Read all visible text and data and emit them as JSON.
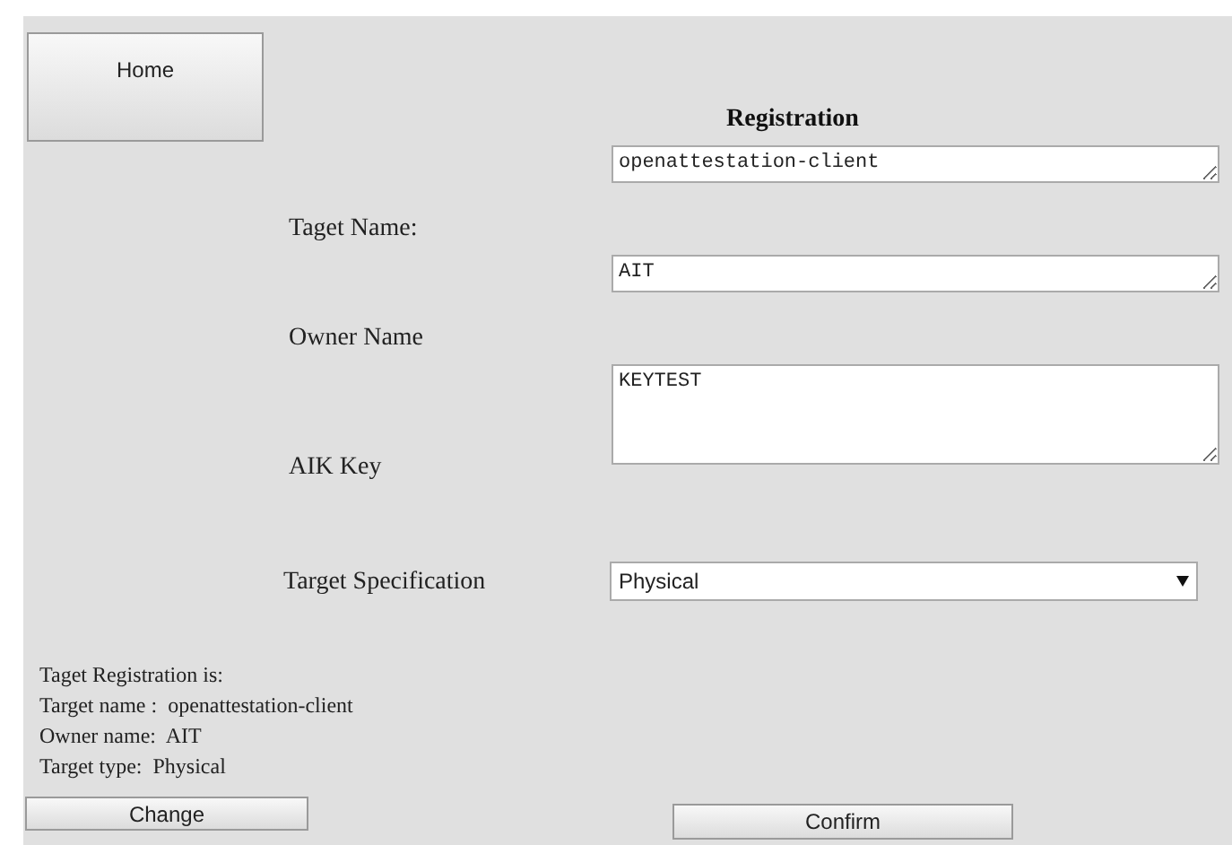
{
  "home_button": "Home",
  "title": "Registration",
  "fields": [
    {
      "kind": "text",
      "label": "Taget Name:",
      "value": "openattestation-client"
    },
    {
      "kind": "text",
      "label": "Owner Name",
      "value": "AIT"
    },
    {
      "kind": "textarea",
      "label": "AIK Key",
      "value": "KEYTEST"
    }
  ],
  "specification": {
    "label": "Target Specification",
    "value": "Physical"
  },
  "summary": [
    "Taget Registration is:",
    "Target name :  openattestation-client",
    "Owner name:  AIT",
    "Target type:  Physical"
  ],
  "buttons": [
    "Change",
    "Confirm"
  ]
}
